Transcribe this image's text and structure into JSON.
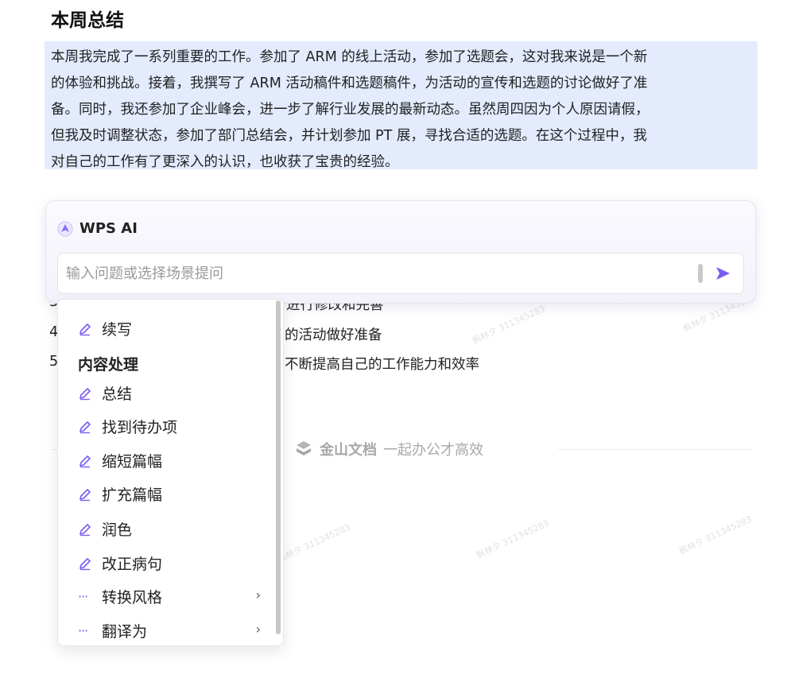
{
  "document": {
    "title": "本周总结",
    "summary_lines": [
      "本周我完成了一系列重要的工作。参加了 ARM 的线上活动，参加了选题会，这对我来说是一个新",
      "的体验和挑战。接着，我撰写了 ARM 活动稿件和选题稿件，为活动的宣传和选题的讨论做好了准",
      "备。同时，我还参加了企业峰会，进一步了解行业发展的最新动态。虽然周四因为个人原因请假，",
      "但我及时调整状态，参加了部门总结会，并计划参加 PT 展，寻找合适的选题。在这个过程中，我",
      "对自己的工作有了更深入的认识，也收获了宝贵的经验。"
    ],
    "partial_lines": [
      {
        "num": "3",
        "text": "进行修改和完善"
      },
      {
        "num": "4",
        "text": "的活动做好准备"
      },
      {
        "num": "5",
        "text": "不断提高自己的工作能力和效率"
      }
    ]
  },
  "footer": {
    "brand": "金山文档",
    "slogan": "一起办公才高效"
  },
  "watermark_text": "枫林夕 311345283",
  "ai_panel": {
    "title": "WPS AI",
    "input_placeholder": "输入问题或选择场景提问",
    "send_icon": "send-arrow-icon"
  },
  "menu": {
    "top_item": "续写",
    "group_label": "内容处理",
    "items": [
      "总结",
      "找到待办项",
      "缩短篇幅",
      "扩充篇幅",
      "润色",
      "改正病句"
    ],
    "submenu_items": [
      "转换风格",
      "翻译为"
    ]
  },
  "colors": {
    "accent": "#7b5cf0",
    "selection_bg": "#e3ebfd"
  }
}
